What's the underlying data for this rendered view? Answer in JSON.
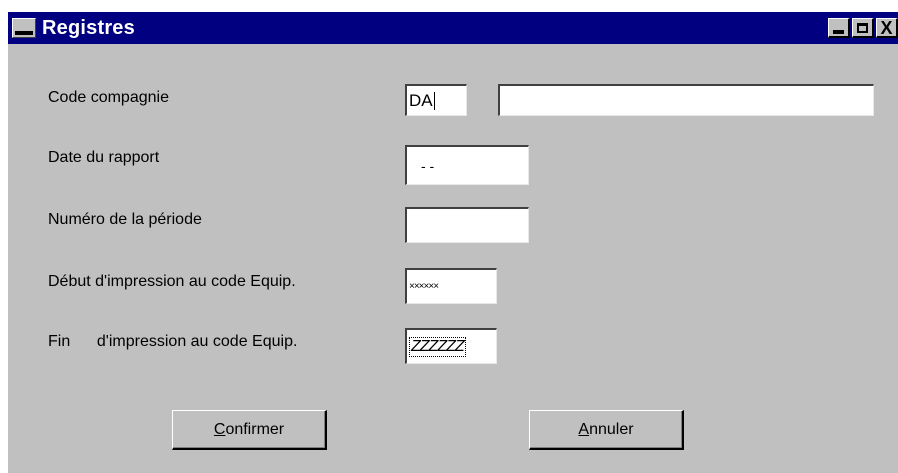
{
  "window": {
    "title": "Registres",
    "minimize_icon": "minimize-icon",
    "maximize_icon": "maximize-icon",
    "close_glyph": "X"
  },
  "form": {
    "code_compagnie_label": "Code compagnie",
    "code_compagnie_value": "DA",
    "code_compagnie_name_value": "",
    "date_rapport_label": "Date du rapport",
    "date_rapport_value": "- -",
    "numero_periode_label": "Numéro de la période",
    "numero_periode_value": "",
    "debut_label": "Début d'impression au code Equip.",
    "debut_value": "××××××",
    "fin_label": "Fin      d'impression au code Equip.",
    "fin_value": "ZZZZZZ"
  },
  "buttons": {
    "confirmer_first": "C",
    "confirmer_rest": "onfirmer",
    "annuler_first": "A",
    "annuler_rest": "nnuler"
  },
  "colors": {
    "titlebar": "#000080",
    "window_bg": "#c0c0c0"
  }
}
